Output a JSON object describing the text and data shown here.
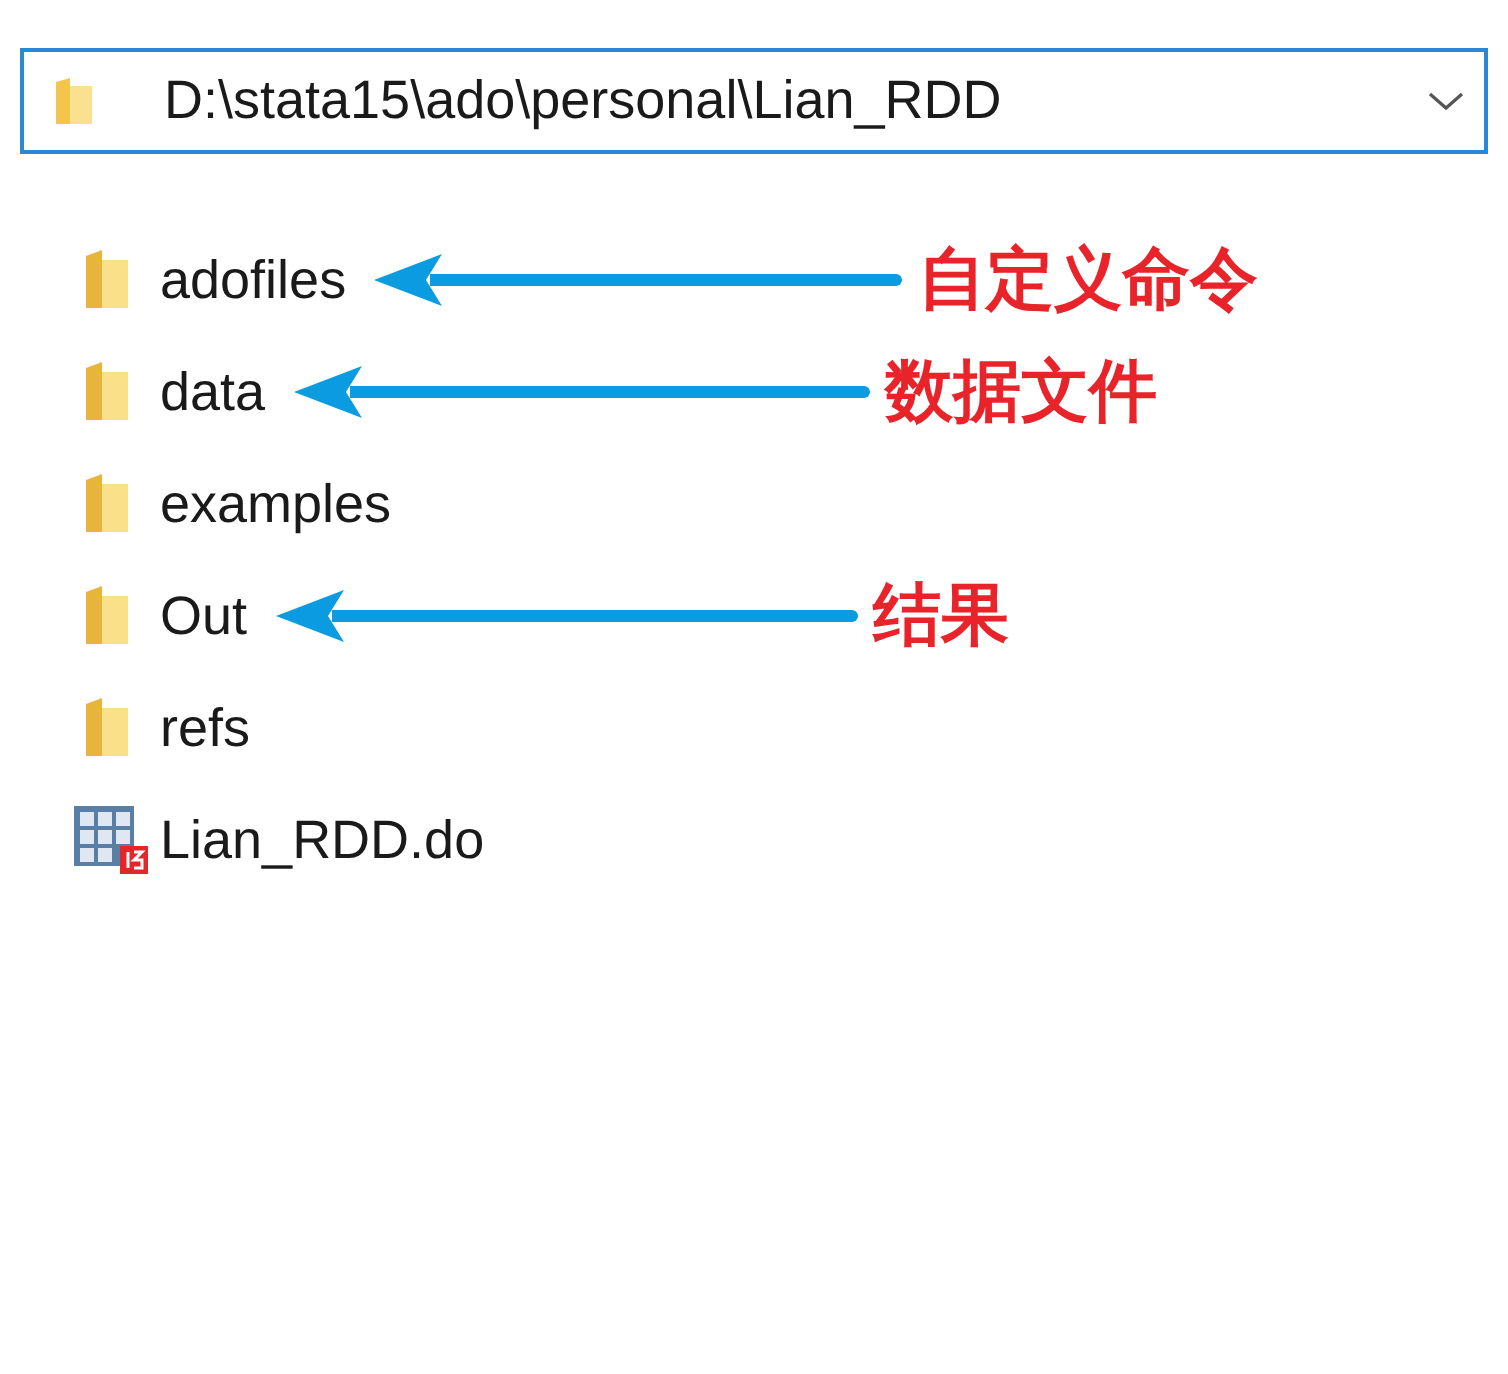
{
  "address_bar": {
    "path": "D:\\stata15\\ado\\personal\\Lian_RDD"
  },
  "files": [
    {
      "kind": "folder",
      "name": "adofiles",
      "annotation": "自定义命令"
    },
    {
      "kind": "folder",
      "name": "data",
      "annotation": "数据文件"
    },
    {
      "kind": "folder",
      "name": "examples"
    },
    {
      "kind": "folder",
      "name": "Out",
      "annotation": "结果"
    },
    {
      "kind": "folder",
      "name": "refs"
    },
    {
      "kind": "do-file",
      "name": "Lian_RDD.do"
    }
  ]
}
